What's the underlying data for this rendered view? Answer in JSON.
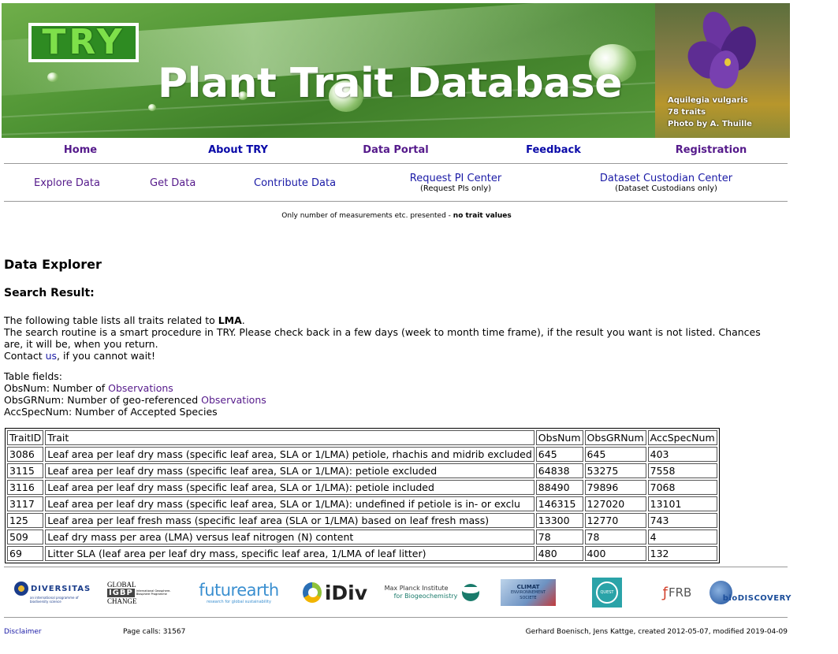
{
  "banner": {
    "logo_text": "TRY",
    "title": "Plant Trait Database",
    "photo_caption": [
      "Aquilegia vulgaris",
      "78 traits",
      "Photo by A. Thuille"
    ]
  },
  "main_nav": [
    "Home",
    "About TRY",
    "Data Portal",
    "Feedback",
    "Registration"
  ],
  "sub_nav": {
    "explore": "Explore Data",
    "get": "Get Data",
    "contribute": "Contribute Data",
    "request_pi": "Request PI Center",
    "request_pi_sub": "(Request PIs only)",
    "custodian": "Dataset Custodian Center",
    "custodian_sub": "(Dataset Custodians only)"
  },
  "note": {
    "prefix": "Only number of measurements etc. presented - ",
    "bold": "no trait values"
  },
  "headings": {
    "explorer": "Data Explorer",
    "search_result": "Search Result:"
  },
  "intro": {
    "line1_prefix": "The following table lists all traits related to ",
    "line1_term": "LMA",
    "line1_suffix": ".",
    "line2": "The search routine is a smart procedure in TRY. Please check back in a few days (week to month time frame), if the result you want is not listed. Chances are, it will be, when you return.",
    "contact_prefix": "Contact ",
    "contact_link": "us",
    "contact_suffix": ", if you cannot wait!"
  },
  "fields": {
    "title": "Table fields:",
    "obsnum_prefix": "ObsNum: Number of ",
    "obsnum_link": "Observations",
    "obsgr_prefix": "ObsGRNum: Number of geo-referenced ",
    "obsgr_link": "Observations",
    "acc": "AccSpecNum: Number of Accepted Species"
  },
  "table": {
    "headers": [
      "TraitID",
      "Trait",
      "ObsNum",
      "ObsGRNum",
      "AccSpecNum"
    ],
    "rows": [
      [
        "3086",
        "Leaf area per leaf dry mass (specific leaf area, SLA or 1/LMA) petiole, rhachis and midrib excluded",
        "645",
        "645",
        "403"
      ],
      [
        "3115",
        "Leaf area per leaf dry mass (specific leaf area, SLA or 1/LMA): petiole excluded",
        "64838",
        "53275",
        "7558"
      ],
      [
        "3116",
        "Leaf area per leaf dry mass (specific leaf area, SLA or 1/LMA): petiole included",
        "88490",
        "79896",
        "7068"
      ],
      [
        "3117",
        "Leaf area per leaf dry mass (specific leaf area, SLA or 1/LMA): undefined if petiole is in- or exclu",
        "146315",
        "127020",
        "13101"
      ],
      [
        "125",
        "Leaf area per leaf fresh mass (specific leaf area (SLA or 1/LMA) based on leaf fresh mass)",
        "13300",
        "12770",
        "743"
      ],
      [
        "509",
        "Leaf dry mass per area (LMA) versus leaf nitrogen (N) content",
        "78",
        "78",
        "4"
      ],
      [
        "69",
        "Litter SLA (leaf area per leaf dry mass, specific leaf area, 1/LMA of leaf litter)",
        "480",
        "400",
        "132"
      ]
    ]
  },
  "partner_logos": {
    "diversitas": "DIVERSITAS",
    "diversitas_sub": "an international programme of biodiversity science",
    "global_1": "GLOBAL",
    "igbp": "IGBP",
    "igbp_side": "International Geosphere-Biosphere Programme",
    "change": "CHANGE",
    "futurearth": "futurearth",
    "futurearth_sub": "research for global sustainability",
    "idiv": "iDiv",
    "mpi_1": "Max Planck Institute",
    "mpi_2": "for Biogeochemistry",
    "climat_1": "CLIMAT",
    "climat_2": "ENVIRONNEMENT",
    "climat_3": "SOCIETE",
    "quest": "QUEST",
    "frb": "FRB",
    "biodiscovery": "bioDISCOVERY"
  },
  "footer": {
    "disclaimer": "Disclaimer",
    "page_calls": "Page calls: 31567",
    "credits": "Gerhard Boenisch, Jens Kattge, created 2012-05-07, modified 2019-04-09"
  }
}
